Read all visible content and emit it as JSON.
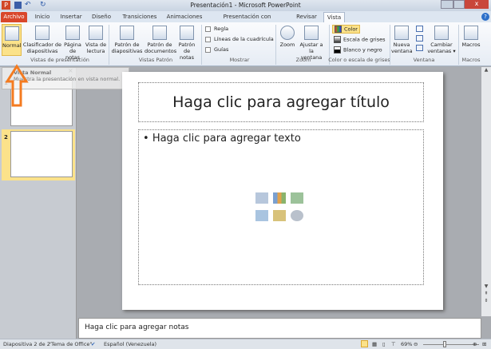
{
  "window": {
    "title": "Presentación1 - Microsoft PowerPoint"
  },
  "tabs": [
    "Archivo",
    "Inicio",
    "Insertar",
    "Diseño",
    "Transiciones",
    "Animaciones",
    "Presentación con diapositivas",
    "Revisar",
    "Vista"
  ],
  "ribbon": {
    "vistas": {
      "label": "Vistas de presentación",
      "buttons": [
        "Normal",
        "Clasificador de diapositivas",
        "Página de notas",
        "Vista de lectura"
      ]
    },
    "patron": {
      "label": "Vistas Patrón",
      "buttons": [
        "Patrón de diapositivas",
        "Patrón de documentos",
        "Patrón de notas"
      ]
    },
    "mostrar": {
      "label": "Mostrar",
      "checks": [
        "Regla",
        "Líneas de la cuadrícula",
        "Guías"
      ]
    },
    "zoom": {
      "label": "Zoom",
      "buttons": [
        "Zoom",
        "Ajustar a la ventana"
      ]
    },
    "color": {
      "label": "Color o escala de grises",
      "options": [
        "Color",
        "Escala de grises",
        "Blanco y negro"
      ]
    },
    "ventana": {
      "label": "Ventana",
      "buttons": [
        "Nueva ventana",
        "Cambiar ventanas ▾"
      ]
    },
    "macros": {
      "label": "Macros",
      "buttons": [
        "Macros"
      ]
    }
  },
  "tooltip": {
    "title": "Vista Normal",
    "text": "Muestra la presentación en vista normal."
  },
  "slides": [
    "1",
    "2"
  ],
  "slide": {
    "title": "Haga clic para agregar título",
    "body": "Haga clic para agregar texto"
  },
  "notes": "Haga clic para agregar notas",
  "status": {
    "slide": "Diapositiva 2 de 2",
    "theme": "\"Tema de Office\"",
    "language": "Español (Venezuela)",
    "zoom": "69%"
  },
  "colors": {
    "file_tab": "#d9472b",
    "highlight": "#fbe28a",
    "annotation_arrow": "#f47b20"
  }
}
